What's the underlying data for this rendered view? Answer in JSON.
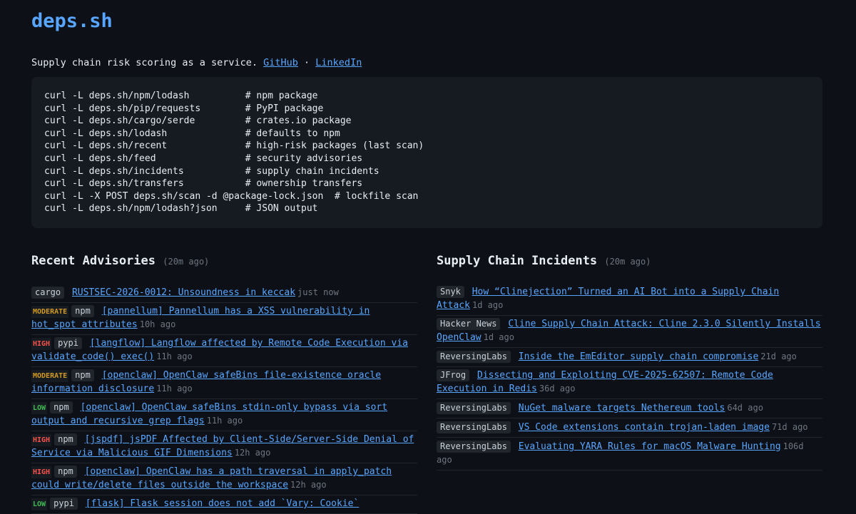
{
  "site": {
    "title": "deps.sh",
    "tagline": "Supply chain risk scoring as a service.",
    "github_label": "GitHub",
    "separator": " · ",
    "linkedin_label": "LinkedIn"
  },
  "usage": [
    "curl -L deps.sh/npm/lodash          # npm package",
    "curl -L deps.sh/pip/requests        # PyPI package",
    "curl -L deps.sh/cargo/serde         # crates.io package",
    "curl -L deps.sh/lodash              # defaults to npm",
    "curl -L deps.sh/recent              # high-risk packages (last scan)",
    "curl -L deps.sh/feed                # security advisories",
    "curl -L deps.sh/incidents           # supply chain incidents",
    "curl -L deps.sh/transfers           # ownership transfers",
    "curl -L -X POST deps.sh/scan -d @package-lock.json  # lockfile scan",
    "curl -L deps.sh/npm/lodash?json     # JSON output"
  ],
  "advisories": {
    "heading": "Recent Advisories",
    "age": "(20m ago)",
    "items": [
      {
        "severity": "",
        "ecosystem": "cargo",
        "title": "RUSTSEC-2026-0012: Unsoundness in keccak",
        "time": "just now"
      },
      {
        "severity": "MODERATE",
        "ecosystem": "npm",
        "title": "[pannellum] Pannellum has a XSS vulnerability in hot_spot attributes",
        "time": "10h ago"
      },
      {
        "severity": "HIGH",
        "ecosystem": "pypi",
        "title": "[langflow] Langflow affected by Remote Code Execution via validate_code() exec()",
        "time": "11h ago"
      },
      {
        "severity": "MODERATE",
        "ecosystem": "npm",
        "title": "[openclaw] OpenClaw safeBins file-existence oracle information disclosure",
        "time": "11h ago"
      },
      {
        "severity": "LOW",
        "ecosystem": "npm",
        "title": "[openclaw] OpenClaw safeBins stdin-only bypass via sort output and recursive grep flags",
        "time": "11h ago"
      },
      {
        "severity": "HIGH",
        "ecosystem": "npm",
        "title": "[jspdf] jsPDF Affected by Client-Side/Server-Side Denial of Service via Malicious GIF Dimensions",
        "time": "12h ago"
      },
      {
        "severity": "HIGH",
        "ecosystem": "npm",
        "title": "[openclaw] OpenClaw has a path traversal in apply_patch could write/delete files outside the workspace",
        "time": "12h ago"
      },
      {
        "severity": "LOW",
        "ecosystem": "pypi",
        "title": "[flask] Flask session does not add `Vary: Cookie`",
        "time": ""
      }
    ]
  },
  "incidents": {
    "heading": "Supply Chain Incidents",
    "age": "(20m ago)",
    "items": [
      {
        "source": "Snyk",
        "title": "How “Clinejection” Turned an AI Bot into a Supply Chain Attack",
        "time": "1d ago"
      },
      {
        "source": "Hacker News",
        "title": "Cline Supply Chain Attack: Cline 2.3.0 Silently Installs OpenClaw",
        "time": "1d ago"
      },
      {
        "source": "ReversingLabs",
        "title": "Inside the EmEditor supply chain compromise",
        "time": "21d ago"
      },
      {
        "source": "JFrog",
        "title": "Dissecting and Exploiting CVE-2025-62507: Remote Code Execution in Redis",
        "time": "36d ago"
      },
      {
        "source": "ReversingLabs",
        "title": "NuGet malware targets Nethereum tools",
        "time": "64d ago"
      },
      {
        "source": "ReversingLabs",
        "title": "VS Code extensions contain trojan-laden image",
        "time": "71d ago"
      },
      {
        "source": "ReversingLabs",
        "title": "Evaluating YARA Rules for macOS Malware Hunting",
        "time": "106d ago"
      }
    ]
  },
  "colors": {
    "background": "#0d1117",
    "link": "#58a6ff",
    "moderate": "#d29922",
    "high": "#f85149",
    "low": "#3fb950"
  }
}
